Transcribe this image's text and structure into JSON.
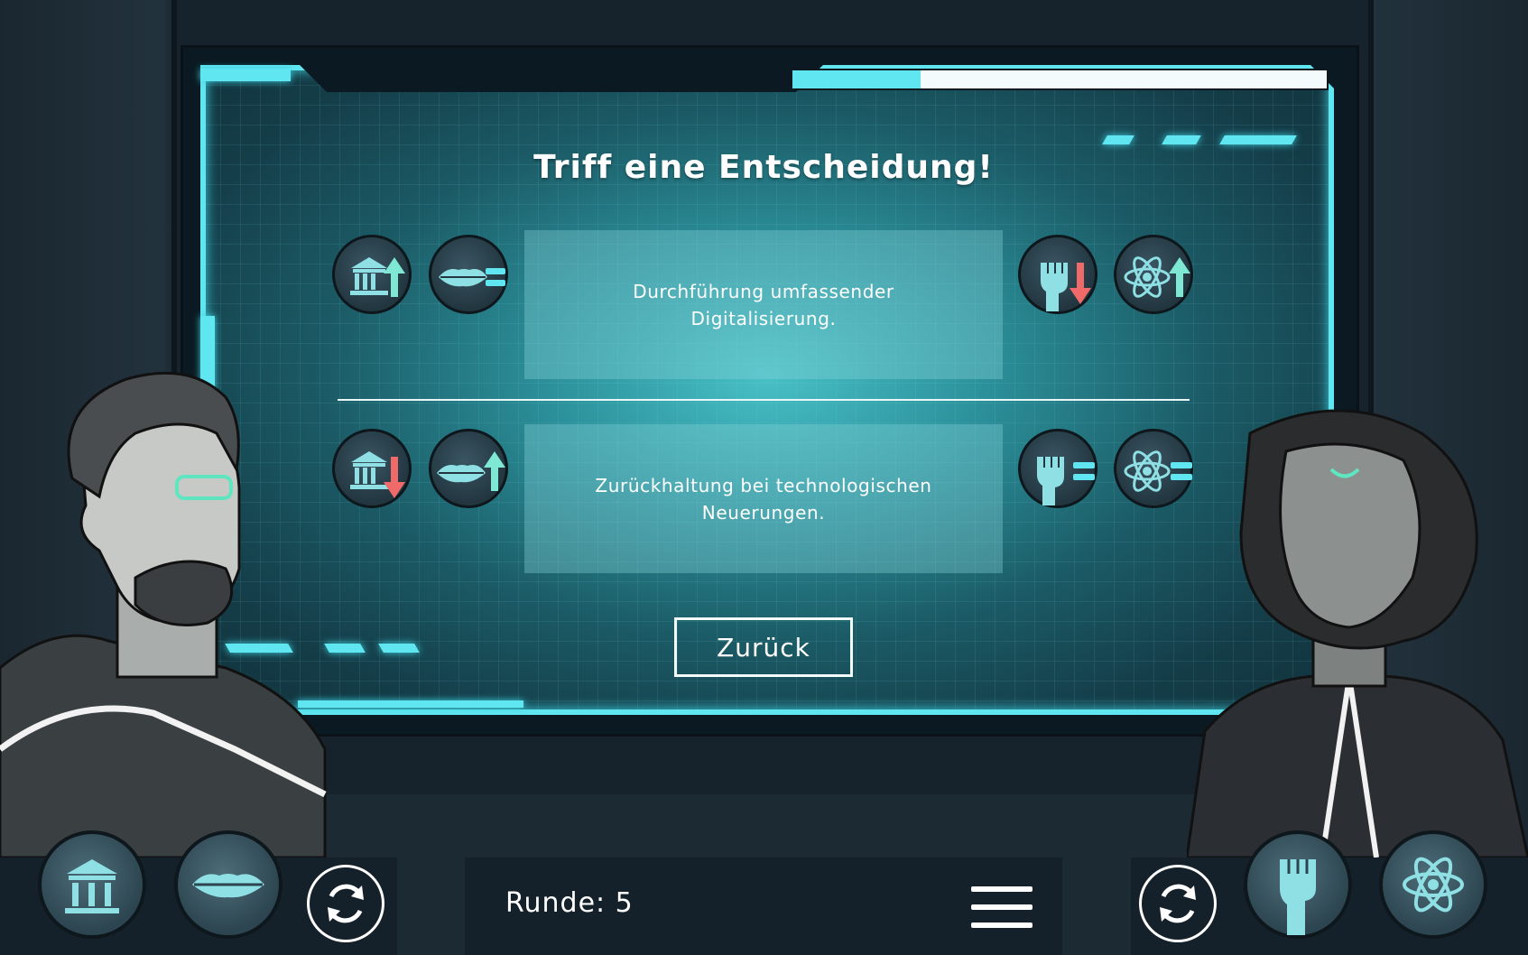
{
  "screen": {
    "title": "Triff eine Entscheidung!",
    "progress_fraction": 0.24
  },
  "options": [
    {
      "text": "Durchführung umfassender Digitalisierung.",
      "left_effects": [
        {
          "icon": "government-icon",
          "change": "up"
        },
        {
          "icon": "lips-icon",
          "change": "equal"
        }
      ],
      "right_effects": [
        {
          "icon": "fist-icon",
          "change": "down"
        },
        {
          "icon": "atom-icon",
          "change": "up"
        }
      ]
    },
    {
      "text": "Zurückhaltung bei technologischen Neuerungen.",
      "left_effects": [
        {
          "icon": "government-icon",
          "change": "down"
        },
        {
          "icon": "lips-icon",
          "change": "up"
        }
      ],
      "right_effects": [
        {
          "icon": "fist-icon",
          "change": "equal"
        },
        {
          "icon": "atom-icon",
          "change": "equal"
        }
      ]
    }
  ],
  "buttons": {
    "back_label": "Zurück"
  },
  "footer": {
    "round_label": "Runde: 5"
  },
  "colors": {
    "accent": "#5fe6f0",
    "up": "#7ee8d4",
    "down": "#f06a6a",
    "equal": "#5fe6f0",
    "icon": "#8fe0e4"
  },
  "characters": {
    "left": {
      "description": "man with glasses and cape"
    },
    "right": {
      "description": "woman with curly hair"
    }
  }
}
